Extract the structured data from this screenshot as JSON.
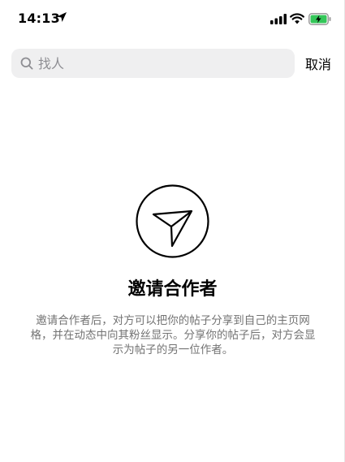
{
  "status_bar": {
    "time": "14:13",
    "icons": [
      "location-arrow-icon",
      "cellular-signal-icon",
      "wifi-icon",
      "battery-charging-icon"
    ],
    "battery_color": "#34c759"
  },
  "search": {
    "placeholder": "找人",
    "value": "",
    "cancel_label": "取消"
  },
  "empty_state": {
    "icon": "paper-plane-icon",
    "title": "邀请合作者",
    "description": "邀请合作者后，对方可以把你的帖子分享到自己的主页网格，并在动态中向其粉丝显示。分享你的帖子后，对方会显示为帖子的另一位作者。"
  }
}
